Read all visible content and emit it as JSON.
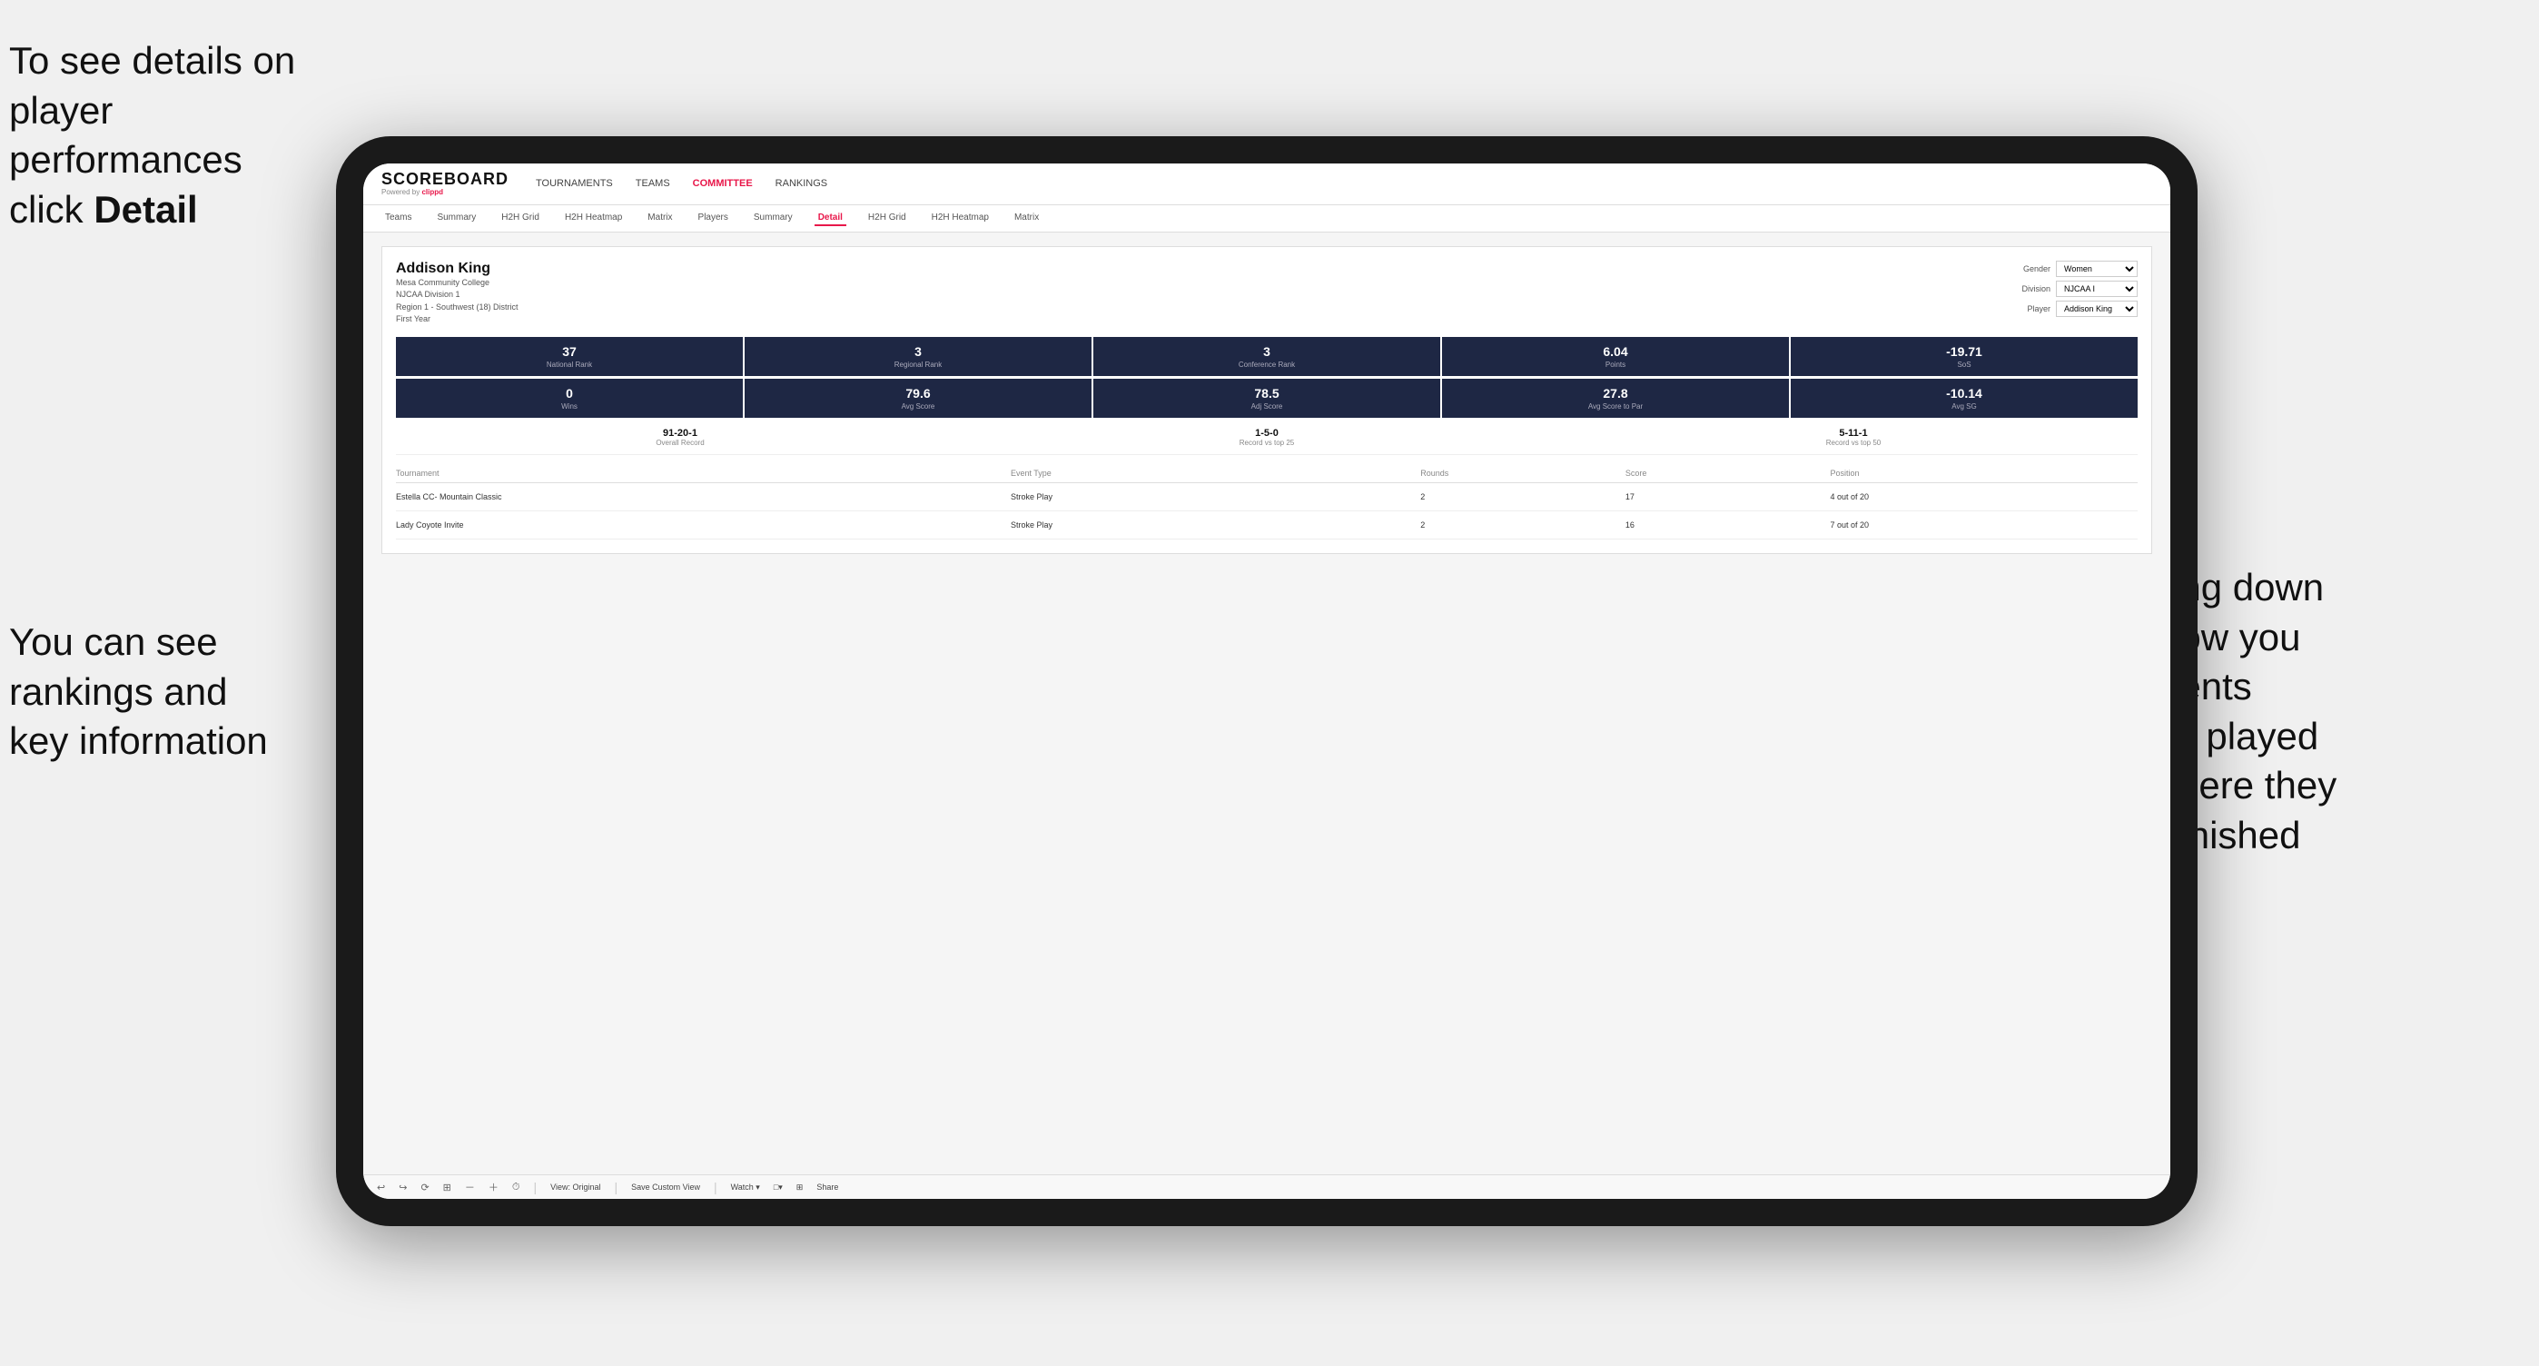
{
  "annotations": {
    "topleft": {
      "line1": "To see details on",
      "line2": "player performances",
      "line3_prefix": "click ",
      "line3_bold": "Detail"
    },
    "bottomleft": {
      "line1": "You can see",
      "line2": "rankings and",
      "line3": "key information"
    },
    "bottomright": {
      "line1": "Scrolling down",
      "line2": "will show you",
      "line3": "the events",
      "line4": "they've played",
      "line5": "and where they",
      "line6": "have finished"
    }
  },
  "app": {
    "logo": {
      "scoreboard": "SCOREBOARD",
      "powered": "Powered by ",
      "clippd": "clippd"
    },
    "topnav": {
      "items": [
        "TOURNAMENTS",
        "TEAMS",
        "COMMITTEE",
        "RANKINGS"
      ]
    },
    "subnav": {
      "items": [
        "Teams",
        "Summary",
        "H2H Grid",
        "H2H Heatmap",
        "Matrix",
        "Players",
        "Summary",
        "Detail",
        "H2H Grid",
        "H2H Heatmap",
        "Matrix"
      ],
      "active": "Detail"
    },
    "player": {
      "name": "Addison King",
      "school": "Mesa Community College",
      "division": "NJCAA Division 1",
      "region": "Region 1 - Southwest (18) District",
      "year": "First Year",
      "gender_label": "Gender",
      "gender_value": "Women",
      "division_label": "Division",
      "division_value": "NJCAA I",
      "player_label": "Player",
      "player_value": "Addison King"
    },
    "stats_row1": [
      {
        "value": "37",
        "label": "National Rank"
      },
      {
        "value": "3",
        "label": "Regional Rank"
      },
      {
        "value": "3",
        "label": "Conference Rank"
      },
      {
        "value": "6.04",
        "label": "Points"
      },
      {
        "value": "-19.71",
        "label": "SoS"
      }
    ],
    "stats_row2": [
      {
        "value": "0",
        "label": "Wins"
      },
      {
        "value": "79.6",
        "label": "Avg Score"
      },
      {
        "value": "78.5",
        "label": "Adj Score"
      },
      {
        "value": "27.8",
        "label": "Avg Score to Par"
      },
      {
        "value": "-10.14",
        "label": "Avg SG"
      }
    ],
    "records": [
      {
        "value": "91-20-1",
        "label": "Overall Record"
      },
      {
        "value": "1-5-0",
        "label": "Record vs top 25"
      },
      {
        "value": "5-11-1",
        "label": "Record vs top 50"
      }
    ],
    "table": {
      "headers": [
        "Tournament",
        "Event Type",
        "Rounds",
        "Score",
        "Position"
      ],
      "rows": [
        {
          "tournament": "Estella CC- Mountain Classic",
          "event_type": "Stroke Play",
          "rounds": "2",
          "score": "17",
          "position": "4 out of 20"
        },
        {
          "tournament": "Lady Coyote Invite",
          "event_type": "Stroke Play",
          "rounds": "2",
          "score": "16",
          "position": "7 out of 20"
        }
      ]
    },
    "toolbar": {
      "items": [
        "↩",
        "↪",
        "⟳",
        "⊞",
        "⊡",
        "⊠",
        "⏱",
        "View: Original",
        "Save Custom View",
        "Watch ▾",
        "□▾",
        "⊞",
        "Share"
      ]
    }
  }
}
